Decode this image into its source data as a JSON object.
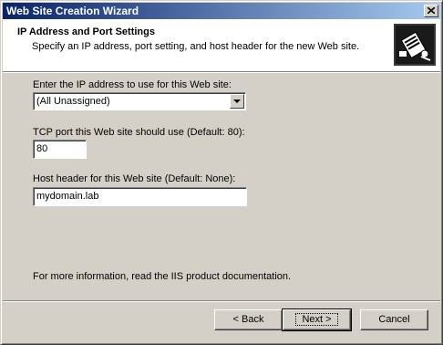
{
  "window": {
    "title": "Web Site Creation Wizard"
  },
  "header": {
    "title": "IP Address and Port Settings",
    "subtitle": "Specify an IP address, port setting, and host header for the new Web site."
  },
  "form": {
    "ip": {
      "label": "Enter the IP address to use for this Web site:",
      "value": "(All Unassigned)"
    },
    "port": {
      "label": "TCP port this Web site should use (Default: 80):",
      "value": "80"
    },
    "host": {
      "label": "Host header for this Web site (Default: None):",
      "value": "mydomain.lab"
    }
  },
  "info_text": "For more information, read the IIS product documentation.",
  "buttons": {
    "back": "Back",
    "next": "Next",
    "cancel": "Cancel"
  },
  "colors": {
    "title_bar_start": "#0a246a",
    "title_bar_end": "#a6caf0",
    "dialog_face": "#d4d0c8"
  }
}
